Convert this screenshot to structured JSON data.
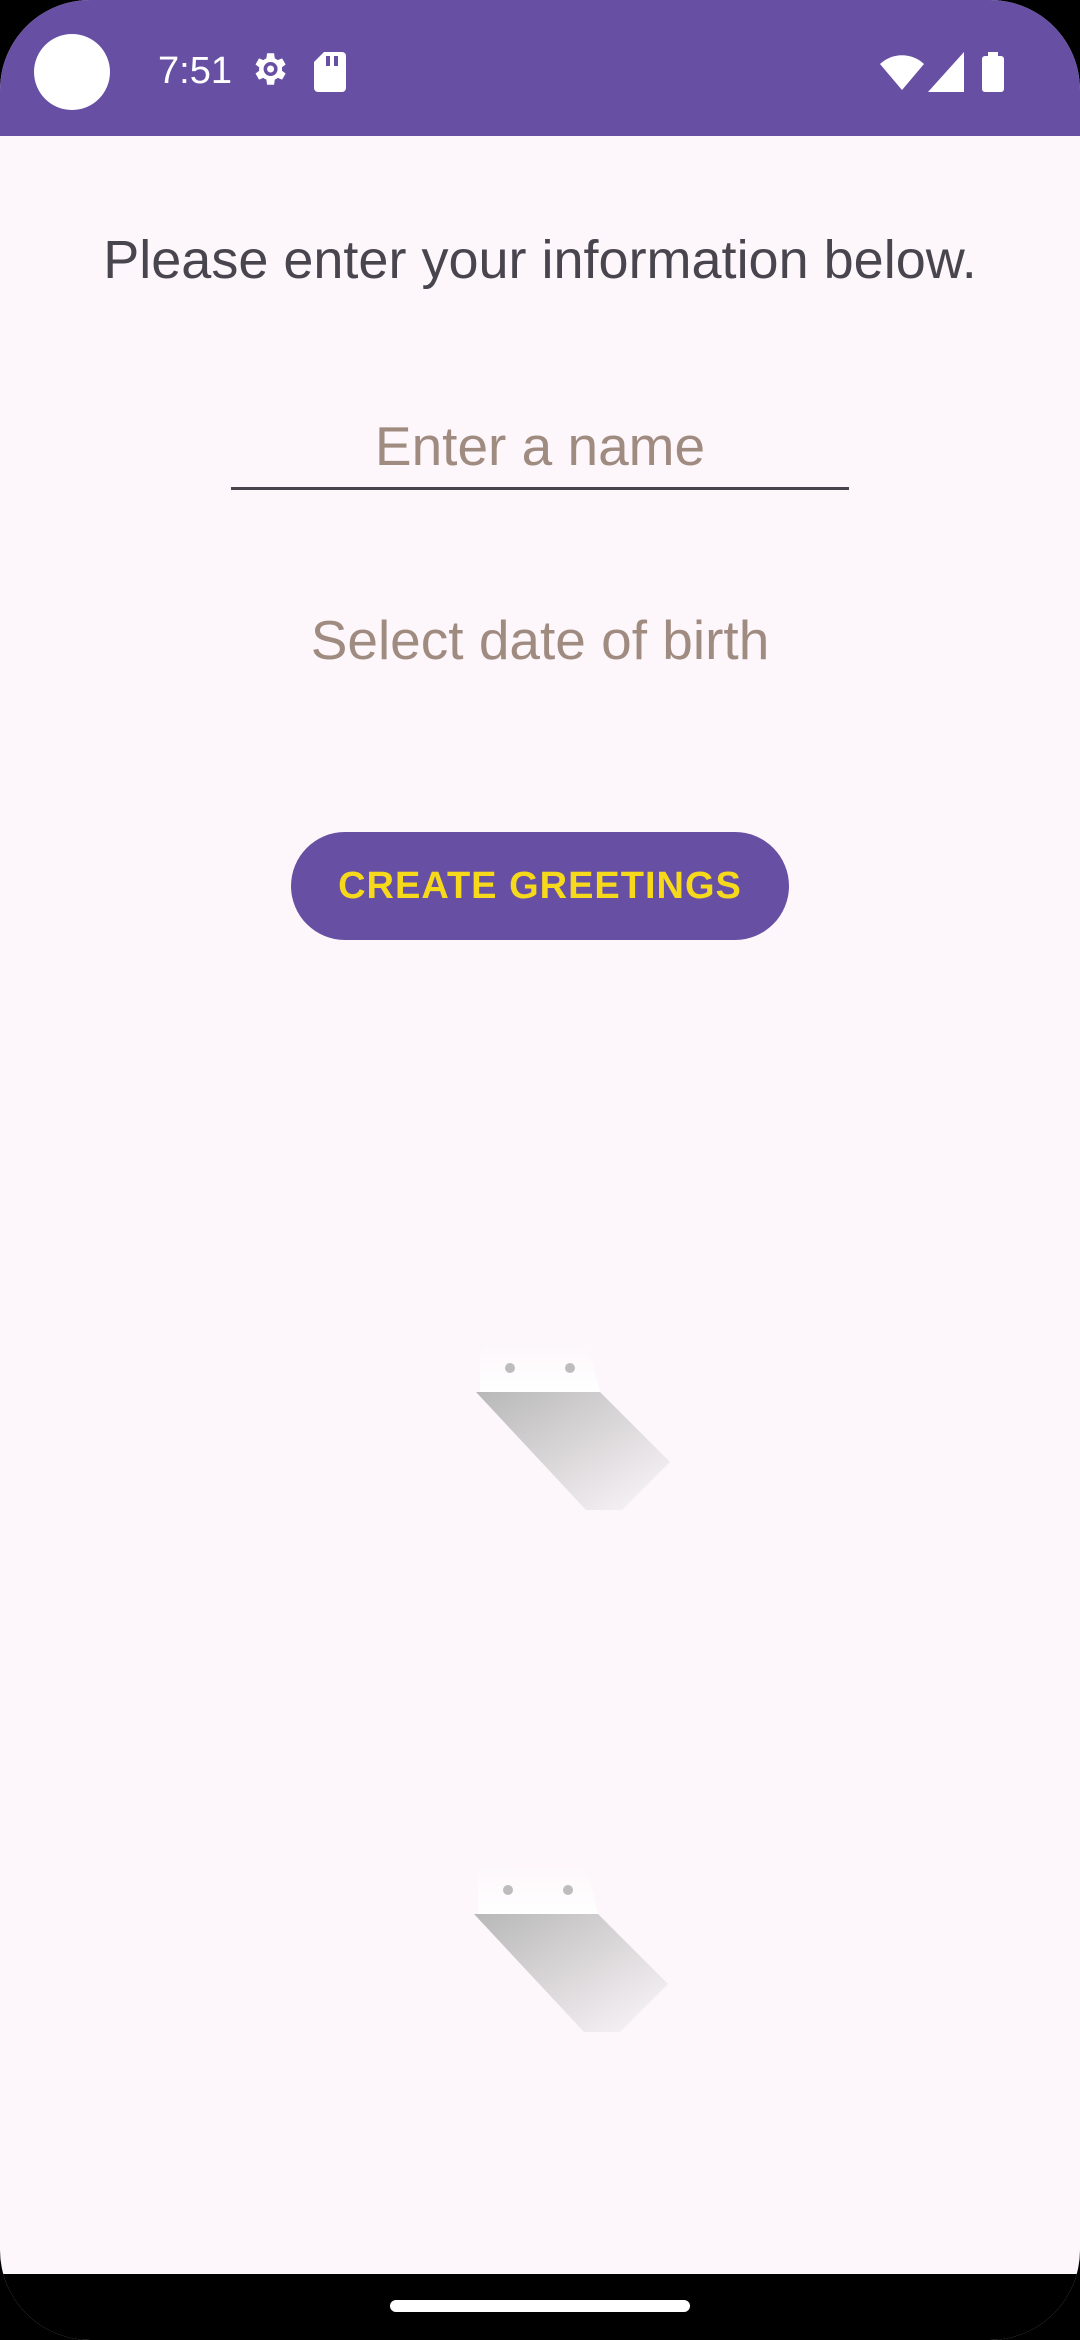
{
  "status_bar": {
    "time": "7:51",
    "background_color": "#6750a4",
    "icons": [
      "gear-icon",
      "sd-card-icon",
      "wifi-icon",
      "cell-signal-icon",
      "battery-icon"
    ]
  },
  "form": {
    "intro": "Please enter your information below.",
    "name_placeholder": "Enter a name",
    "name_value": "",
    "dob_label": "Select date of birth",
    "create_button_label": "CREATE GREETINGS"
  },
  "colors": {
    "primary": "#6750a4",
    "button_text": "#f7d91c",
    "hint_text": "#a08b80",
    "background": "#fdf7fb"
  }
}
